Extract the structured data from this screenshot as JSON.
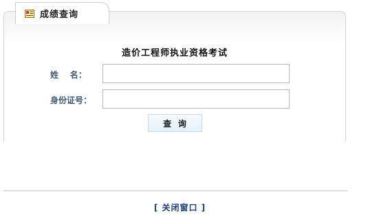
{
  "tab": {
    "title": "成绩查询",
    "icon": "certificate-icon"
  },
  "form": {
    "title": "造价工程师执业资格考试",
    "name_label": "姓    名：",
    "name_value": "",
    "id_label": "身份证号：",
    "id_value": "",
    "query_button": "查  询"
  },
  "footer": {
    "close_link": "[ 关闭窗口 ]"
  },
  "colors": {
    "label": "#3f5872",
    "link": "#1b3e7a",
    "button_bg": "#e4f1fa",
    "border": "#d4d4d4"
  }
}
